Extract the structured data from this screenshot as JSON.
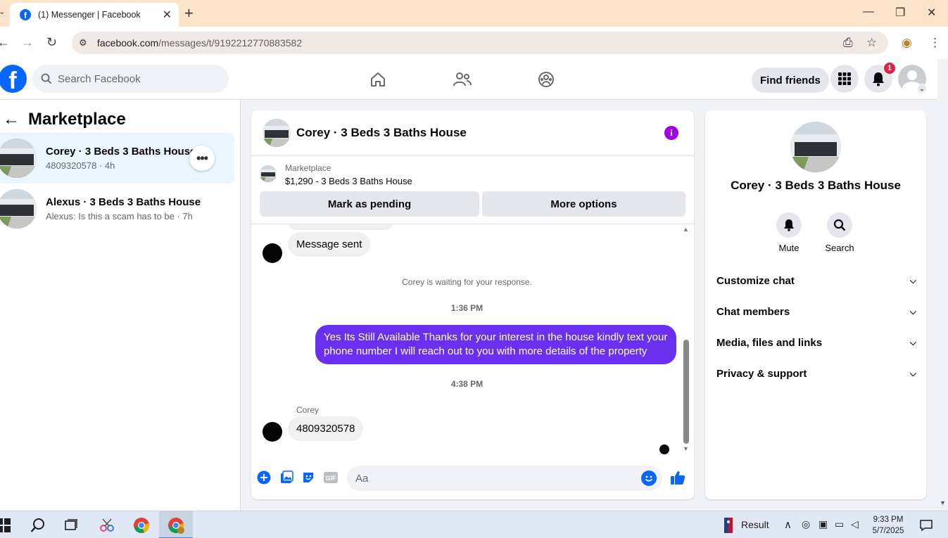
{
  "browser": {
    "tab_title": "(1) Messenger | Facebook",
    "url_host": "facebook.com",
    "url_path": "/messages/t/9192212770883582"
  },
  "fb": {
    "search_placeholder": "Search Facebook",
    "find_friends": "Find friends",
    "notification_count": "1"
  },
  "left": {
    "title": "Marketplace",
    "conversations": [
      {
        "name": "Corey · 3 Beds 3 Baths House",
        "sub": "4809320578 · 4h",
        "active": true
      },
      {
        "name": "Alexus · 3 Beds 3 Baths House",
        "sub": "Alexus: Is this a scam has to be · 7h",
        "active": false
      }
    ]
  },
  "chat": {
    "title": "Corey · 3 Beds 3 Baths House",
    "marketplace_label": "Marketplace",
    "listing": "$1,290 - 3 Beds 3 Baths House",
    "mark_pending": "Mark as pending",
    "more_options": "More options",
    "messages": {
      "msg1": "Message sent",
      "waiting": "Corey is waiting for your response.",
      "time1": "1:36 PM",
      "outgoing": "Yes Its Still Available Thanks for your interest in the house kindly text your phone number I will reach out to you with more details of the property",
      "time2": "4:38 PM",
      "sender": "Corey",
      "msg2": "4809320578"
    },
    "composer_placeholder": "Aa",
    "accent_color": "#6b2ff0"
  },
  "right": {
    "name": "Corey · 3 Beds 3 Baths House",
    "mute": "Mute",
    "search": "Search",
    "items": [
      "Customize chat",
      "Chat members",
      "Media, files and links",
      "Privacy & support"
    ]
  },
  "taskbar": {
    "result_label": "Result",
    "time": "9:33 PM",
    "date": "5/7/2025"
  }
}
